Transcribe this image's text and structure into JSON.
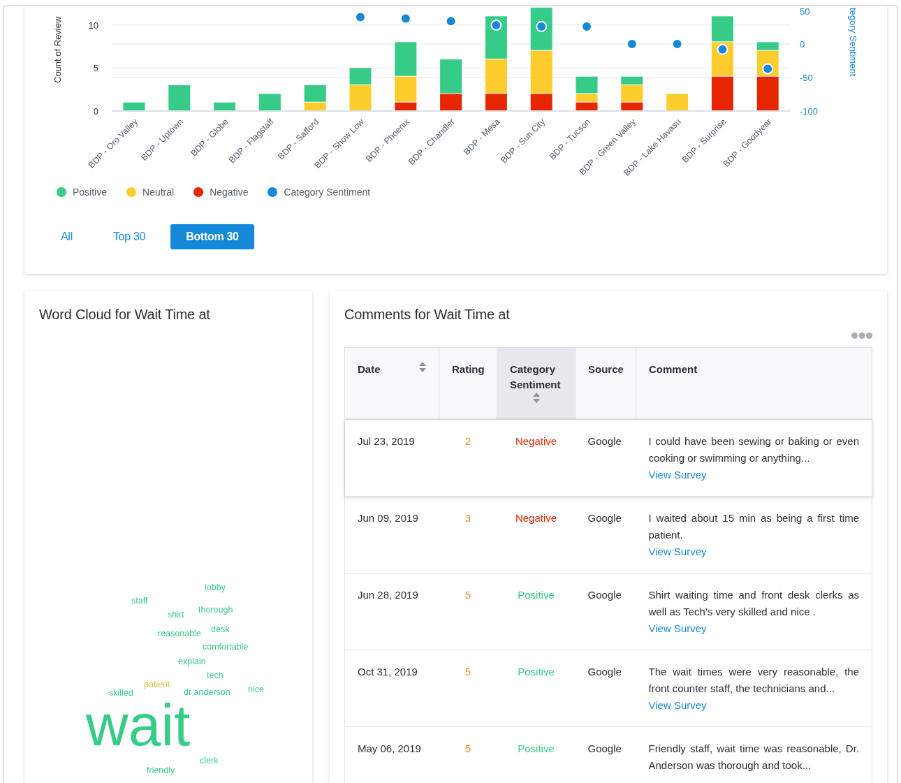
{
  "chart_card": {
    "chart_data": {
      "type": "bar",
      "stacked": true,
      "grid": true,
      "ylabel": "Count of Review",
      "ylim": [
        0,
        12
      ],
      "yticks": [
        0,
        5,
        10
      ],
      "y2label": "tegory Sentiment",
      "y2lim": [
        -100,
        50
      ],
      "y2ticks": [
        -100,
        -50,
        0,
        50
      ],
      "categories": [
        "BDP - Oro Valley",
        "BDP - Uptown",
        "BDP - Globe",
        "BDP - Flagstaff",
        "BDP - Safford",
        "BDP - Show Low",
        "BDP - Phoenix",
        "BDP - Chandler",
        "BDP - Mesa",
        "BDP - Sun City",
        "BDP - Tucson",
        "BDP - Green Valley",
        "BDP - Lake Havasu",
        "BDP - Surprise",
        "BDP - Goodyear"
      ],
      "series": [
        {
          "name": "Positive",
          "color": "#36cc88",
          "values": [
            1,
            3,
            1,
            2,
            2,
            2,
            4,
            4,
            5,
            5,
            2,
            1,
            0,
            3,
            1
          ]
        },
        {
          "name": "Neutral",
          "color": "#fecd2d",
          "values": [
            0,
            0,
            0,
            0,
            1,
            3,
            3,
            0,
            4,
            5,
            1,
            2,
            2,
            4,
            3
          ]
        },
        {
          "name": "Negative",
          "color": "#e62600",
          "values": [
            0,
            0,
            0,
            0,
            0,
            0,
            1,
            2,
            2,
            2,
            1,
            1,
            0,
            4,
            4
          ]
        },
        {
          "name": "Category Sentiment",
          "color": "#1589d9",
          "type": "scatter",
          "axis": "y2",
          "values": [
            null,
            null,
            null,
            null,
            null,
            40,
            38,
            34,
            28,
            26,
            26,
            0,
            0,
            -8,
            -37
          ]
        }
      ]
    },
    "period_buttons": [
      {
        "label": "All",
        "selected": false
      },
      {
        "label": "Top 30",
        "selected": false
      },
      {
        "label": "Bottom 30",
        "selected": true
      }
    ]
  },
  "word_cloud": {
    "title": "Word Cloud for Wait Time at",
    "words": [
      {
        "text": "lobby",
        "color": "#36cc88",
        "kind": "minor"
      },
      {
        "text": "staff",
        "color": "#36cc88",
        "kind": "minor"
      },
      {
        "text": "shirt",
        "color": "#36cc88",
        "kind": "minor"
      },
      {
        "text": "thorough",
        "color": "#36cc88",
        "kind": "minor"
      },
      {
        "text": "reasonable",
        "color": "#36cc88",
        "kind": "minor"
      },
      {
        "text": "desk",
        "color": "#36cc88",
        "kind": "minor"
      },
      {
        "text": "comfortable",
        "color": "#36cc88",
        "kind": "minor"
      },
      {
        "text": "explain",
        "color": "#36cc88",
        "kind": "minor"
      },
      {
        "text": "tech",
        "color": "#36cc88",
        "kind": "minor"
      },
      {
        "text": "patient",
        "color": "#e0c23a",
        "kind": "minor"
      },
      {
        "text": "skilled",
        "color": "#36cc88",
        "kind": "minor"
      },
      {
        "text": "dr anderson",
        "color": "#36cc88",
        "kind": "minor"
      },
      {
        "text": "nice",
        "color": "#36cc88",
        "kind": "minor"
      },
      {
        "text": "wait",
        "color": "#36cc88",
        "kind": "major"
      },
      {
        "text": "clerk",
        "color": "#36cc88",
        "kind": "minor"
      },
      {
        "text": "friendly",
        "color": "#36cc88",
        "kind": "minor"
      }
    ]
  },
  "comments": {
    "title": "Comments for Wait Time at",
    "columns": [
      {
        "label": "Date",
        "kind": "sortable",
        "sorted": false
      },
      {
        "label": "Rating",
        "kind": "plain",
        "sorted": false
      },
      {
        "label": "Category Sentiment",
        "kind": "sortable",
        "sorted": true
      },
      {
        "label": "Source",
        "kind": "plain",
        "sorted": false
      },
      {
        "label": "Comment",
        "kind": "plain",
        "sorted": false
      }
    ],
    "rows": [
      {
        "date": "Jul 23, 2019",
        "rating": "2",
        "sentiment": "Negative",
        "kind": "negative",
        "source": "Google",
        "comment": "I could have been sewing or baking or even cooking or swimming or anything...",
        "link": "View Survey",
        "hovered": true
      },
      {
        "date": "Jun 09, 2019",
        "rating": "3",
        "sentiment": "Negative",
        "kind": "negative",
        "source": "Google",
        "comment": "I waited about 15 min as being a first time patient.",
        "link": "View Survey",
        "hovered": false
      },
      {
        "date": "Jun 28, 2019",
        "rating": "5",
        "sentiment": "Positive",
        "kind": "positive",
        "source": "Google",
        "comment": "Shirt waiting time and front desk clerks as well as Tech's very skilled and nice .",
        "link": "View Survey",
        "hovered": false
      },
      {
        "date": "Oct 31, 2019",
        "rating": "5",
        "sentiment": "Positive",
        "kind": "positive",
        "source": "Google",
        "comment": "The wait times were very reasonable, the front counter staff, the technicians and...",
        "link": "View Survey",
        "hovered": false
      },
      {
        "date": "May 06, 2019",
        "rating": "5",
        "sentiment": "Positive",
        "kind": "positive",
        "source": "Google",
        "comment": "Friendly staff, wait time was reasonable, Dr. Anderson was thorough and took...",
        "hovered": false
      }
    ]
  }
}
